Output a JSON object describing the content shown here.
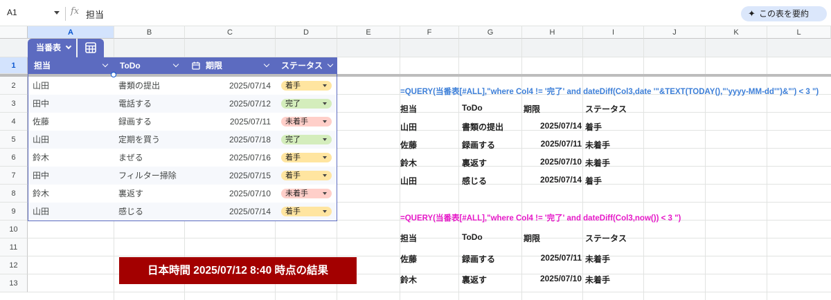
{
  "formula_bar": {
    "cell_ref": "A1",
    "fx": "fx",
    "content": "担当",
    "summarize_label": "この表を要約"
  },
  "columns": [
    "A",
    "B",
    "C",
    "D",
    "E",
    "F",
    "G",
    "H",
    "I",
    "J",
    "K",
    "L"
  ],
  "rows": [
    "1",
    "2",
    "3",
    "4",
    "5",
    "6",
    "7",
    "8",
    "9",
    "10",
    "11",
    "12",
    "13"
  ],
  "table": {
    "name": "当番表",
    "headers": [
      "担当",
      "ToDo",
      "期限",
      "ステータス"
    ],
    "rows": [
      {
        "person": "山田",
        "todo": "書類の提出",
        "due": "2025/07/14",
        "status": "着手"
      },
      {
        "person": "田中",
        "todo": "電話する",
        "due": "2025/07/12",
        "status": "完了"
      },
      {
        "person": "佐藤",
        "todo": "録画する",
        "due": "2025/07/11",
        "status": "未着手"
      },
      {
        "person": "山田",
        "todo": "定期を買う",
        "due": "2025/07/18",
        "status": "完了"
      },
      {
        "person": "鈴木",
        "todo": "まぜる",
        "due": "2025/07/16",
        "status": "着手"
      },
      {
        "person": "田中",
        "todo": "フィルター掃除",
        "due": "2025/07/15",
        "status": "着手"
      },
      {
        "person": "鈴木",
        "todo": "裏返す",
        "due": "2025/07/10",
        "status": "未着手"
      },
      {
        "person": "山田",
        "todo": "感じる",
        "due": "2025/07/14",
        "status": "着手"
      }
    ]
  },
  "status_colors": {
    "着手": "#ffe5a0",
    "完了": "#d4edbc",
    "未着手": "#ffcfc9"
  },
  "query1": {
    "formula": "=QUERY(当番表[#ALL],\"where Col4 != '完了' and dateDiff(Col3,date '\"&TEXT(TODAY(),\"'yyyy-MM-dd'\")&\"') < 3 \")",
    "color": "#3d7fd8",
    "headers": [
      "担当",
      "ToDo",
      "期限",
      "ステータス"
    ],
    "rows": [
      [
        "山田",
        "書類の提出",
        "2025/07/14",
        "着手"
      ],
      [
        "佐藤",
        "録画する",
        "2025/07/11",
        "未着手"
      ],
      [
        "鈴木",
        "裏返す",
        "2025/07/10",
        "未着手"
      ],
      [
        "山田",
        "感じる",
        "2025/07/14",
        "着手"
      ]
    ]
  },
  "query2": {
    "formula": "=QUERY(当番表[#ALL],\"where Col4 != '完了' and dateDiff(Col3,now()) < 3 \")",
    "color": "#e619c8",
    "headers": [
      "担当",
      "ToDo",
      "期限",
      "ステータス"
    ],
    "rows": [
      [
        "佐藤",
        "録画する",
        "2025/07/11",
        "未着手"
      ],
      [
        "鈴木",
        "裏返す",
        "2025/07/10",
        "未着手"
      ]
    ]
  },
  "banner": {
    "text": "日本時間 2025/07/12 8:40 時点の結果"
  }
}
